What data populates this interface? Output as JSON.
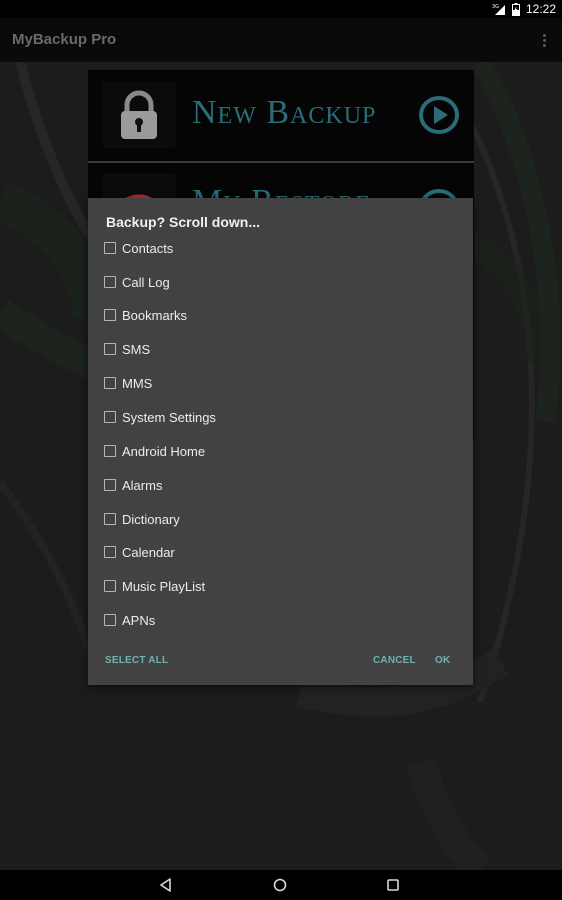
{
  "status_bar": {
    "network": "3G",
    "time": "12:22",
    "icons": [
      "signal-3g-icon",
      "battery-charging-icon"
    ]
  },
  "app_bar": {
    "title": "MyBackup Pro",
    "overflow_icon": "overflow-menu-icon"
  },
  "home_menu": {
    "items": [
      {
        "label": "New Backup",
        "icon": "padlock-icon",
        "action_icon": "play-circle-icon"
      },
      {
        "label": "My Restore",
        "icon": "lifebuoy-icon",
        "action_icon": "play-circle-icon"
      }
    ]
  },
  "dialog": {
    "title": "Backup? Scroll down...",
    "options": [
      {
        "label": "Contacts",
        "checked": false
      },
      {
        "label": "Call Log",
        "checked": false
      },
      {
        "label": "Bookmarks",
        "checked": false
      },
      {
        "label": "SMS",
        "checked": false
      },
      {
        "label": "MMS",
        "checked": false
      },
      {
        "label": "System Settings",
        "checked": false
      },
      {
        "label": "Android Home",
        "checked": false
      },
      {
        "label": "Alarms",
        "checked": false
      },
      {
        "label": "Dictionary",
        "checked": false
      },
      {
        "label": "Calendar",
        "checked": false
      },
      {
        "label": "Music PlayList",
        "checked": false
      },
      {
        "label": "APNs",
        "checked": false
      }
    ],
    "buttons": {
      "select_all": "SELECT ALL",
      "cancel": "CANCEL",
      "ok": "OK"
    },
    "accent_color": "#6fb3b0"
  },
  "nav_bar": {
    "back": "back-icon",
    "home": "home-icon",
    "recents": "recents-icon"
  }
}
